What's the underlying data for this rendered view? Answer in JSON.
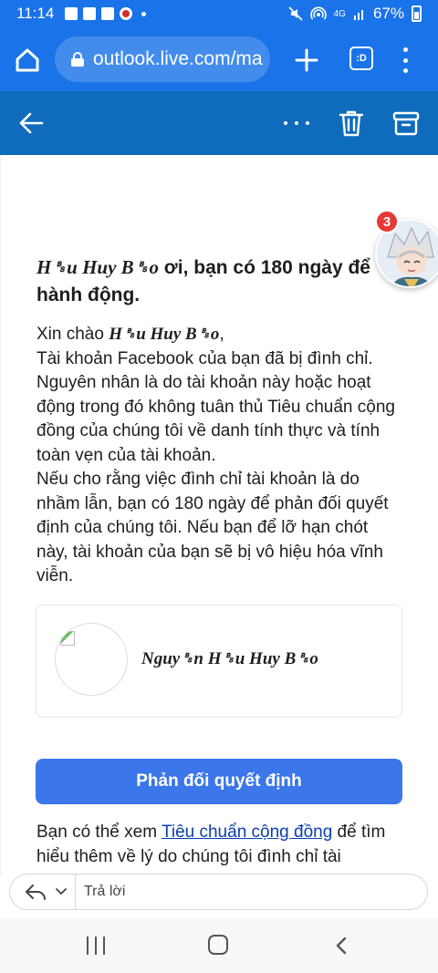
{
  "status_bar": {
    "time": "11:14",
    "network": "4G",
    "battery": "67%"
  },
  "browser": {
    "url": "outlook.live.com/ma",
    "tab_switcher_label": ":D"
  },
  "email": {
    "headline_name": "H␈u Huy B␈o",
    "headline_rest": " ơi, bạn có 180 ngày để hành động.",
    "greeting_prefix": "Xin chào ",
    "greeting_name": "H␈u Huy B␈o",
    "greeting_suffix": ",",
    "paragraph1": "Tài khoản Facebook của bạn đã bị đình chỉ. Nguyên nhân là do tài khoản này hoặc hoạt động trong đó không tuân thủ Tiêu chuẩn cộng đồng của chúng tôi về danh tính thực và tính toàn vẹn của tài khoản.",
    "paragraph2": "Nếu cho rằng việc đình chỉ tài khoản là do nhầm lẫn, bạn có 180 ngày để phản đối quyết định của chúng tôi. Nếu bạn để lỡ hạn chót này, tài khoản của bạn sẽ bị vô hiệu hóa vĩnh viễn.",
    "profile_name": "Nguy␈n H␈u Huy B␈o",
    "appeal_button": "Phản đối quyết định",
    "footer_prefix": "Bạn có thể xem ",
    "footer_link": "Tiêu chuẩn cộng đồng",
    "footer_suffix": " để tìm hiểu thêm về lý do chúng tôi đình chỉ tài"
  },
  "chat_bubble": {
    "badge_count": "3"
  },
  "reply_bar": {
    "placeholder": "Trả lời"
  },
  "colors": {
    "browser_blue": "#1a73e8",
    "outlook_blue": "#0f6cbd",
    "button_blue": "#3b76ea",
    "link": "#0a3fb1"
  }
}
